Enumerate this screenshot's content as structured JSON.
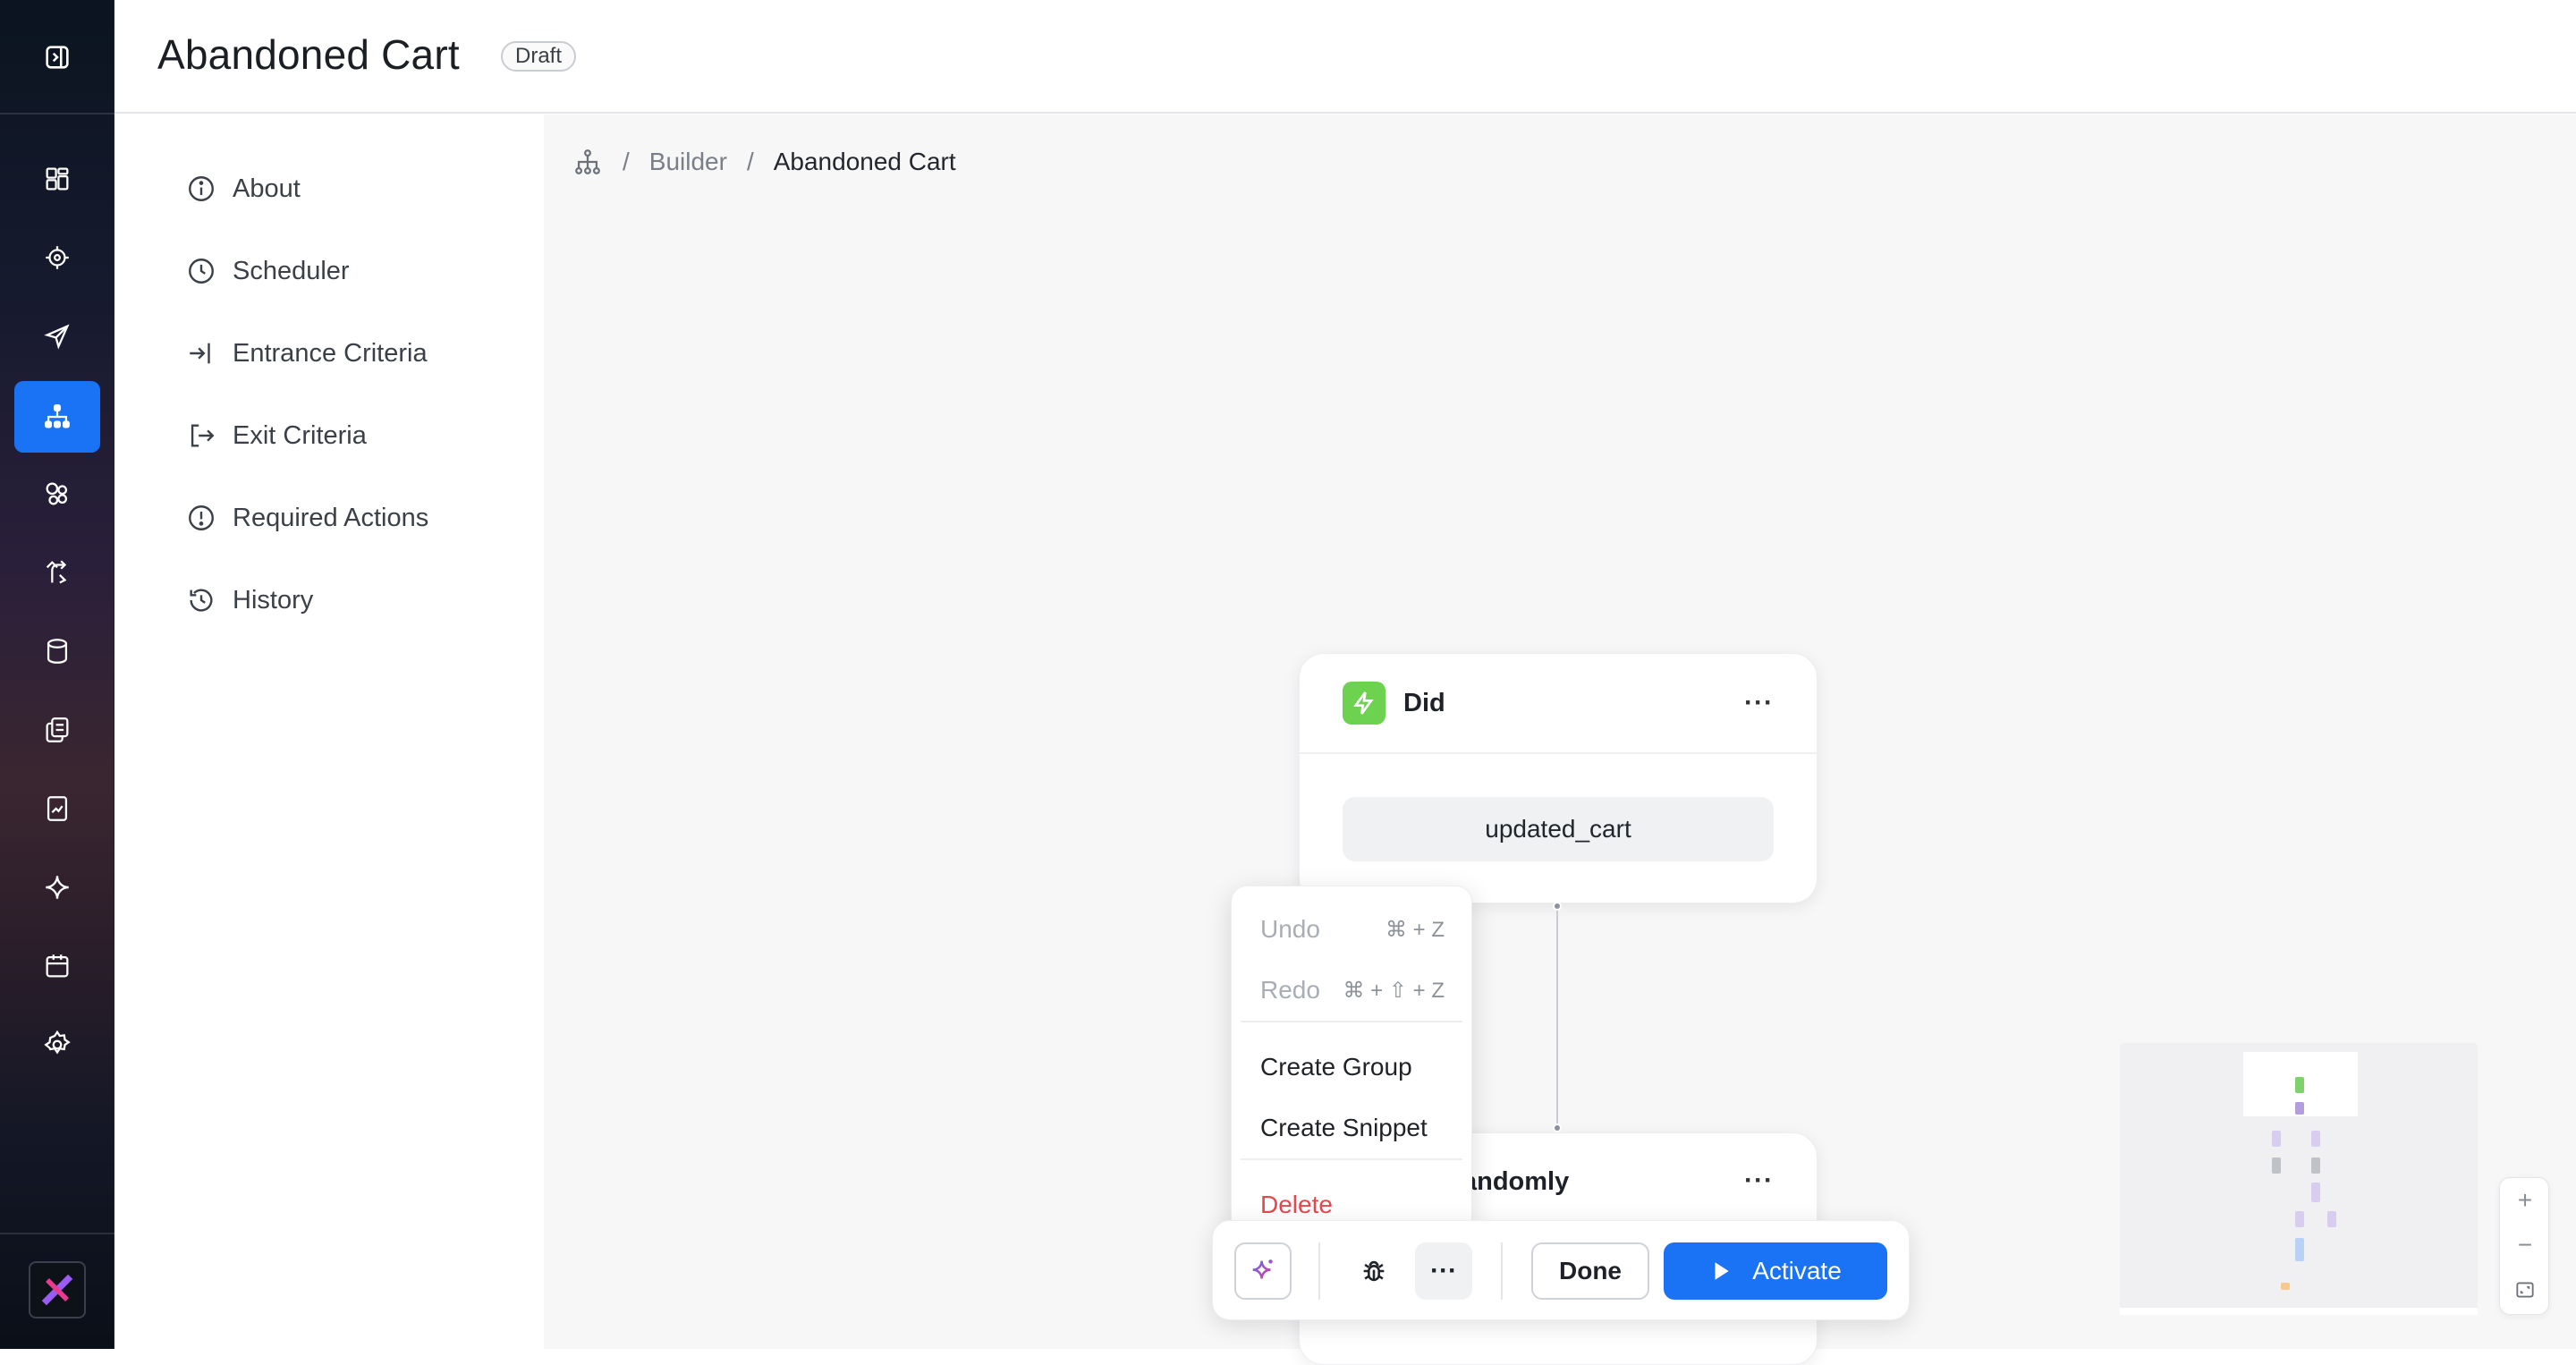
{
  "header": {
    "title": "Abandoned Cart",
    "status_badge": "Draft"
  },
  "rail": {
    "icons": [
      "sidebar-toggle-icon",
      "dashboard-icon",
      "target-icon",
      "send-icon",
      "journey-icon",
      "segments-icon",
      "routing-icon",
      "database-icon",
      "library-icon",
      "report-icon",
      "ai-sparkle-icon",
      "calendar-icon",
      "settings-icon",
      "logo-icon"
    ],
    "active": "journey-icon"
  },
  "nav": {
    "items": [
      {
        "label": "About",
        "icon": "info-icon"
      },
      {
        "label": "Scheduler",
        "icon": "clock-icon"
      },
      {
        "label": "Entrance Criteria",
        "icon": "enter-icon"
      },
      {
        "label": "Exit Criteria",
        "icon": "exit-icon"
      },
      {
        "label": "Required Actions",
        "icon": "alert-icon"
      },
      {
        "label": "History",
        "icon": "history-icon"
      }
    ]
  },
  "breadcrumb": {
    "sep": "/",
    "parent": "Builder",
    "current": "Abandoned Cart"
  },
  "nodes": {
    "did": {
      "title": "Did",
      "event": "updated_cart",
      "more": "···"
    },
    "randomly": {
      "title_visible": "andomly",
      "more": "···"
    }
  },
  "context_menu": {
    "undo": {
      "label": "Undo",
      "shortcut": "⌘ + Z"
    },
    "redo": {
      "label": "Redo",
      "shortcut": "⌘ + ⇧ + Z"
    },
    "create_group": "Create Group",
    "create_snippet": "Create Snippet",
    "delete": "Delete"
  },
  "toolbar": {
    "more": "···",
    "done": "Done",
    "activate": "Activate"
  },
  "zoom": {
    "in": "+",
    "out": "−"
  },
  "colors": {
    "accent": "#1a73f5",
    "trigger": "#6dd24f",
    "danger": "#e5484d"
  }
}
